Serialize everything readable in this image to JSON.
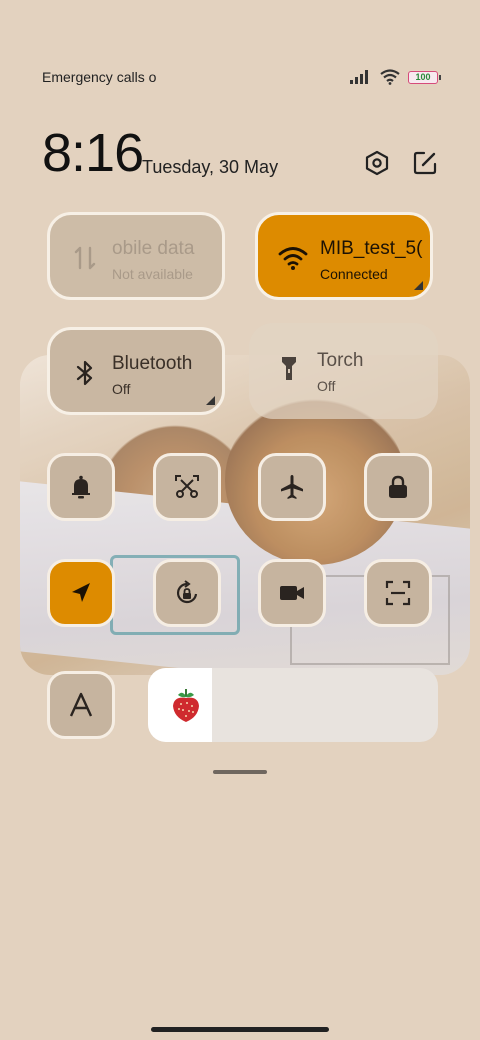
{
  "status_bar": {
    "carrier_text": "Emergency calls o",
    "battery_level": "100",
    "signal_icon": "signal-bars-icon",
    "wifi_icon": "wifi-icon"
  },
  "header": {
    "time": "8:16",
    "date": "Tuesday, 30 May",
    "settings_icon": "settings-hexagon-icon",
    "edit_icon": "edit-icon"
  },
  "tiles": {
    "mobile_data": {
      "title": "obile data",
      "subtitle": "Not available",
      "icon": "mobile-data-arrows-icon",
      "state": "unavailable"
    },
    "wifi": {
      "title": "MIB_test_5(",
      "subtitle": "Connected",
      "icon": "wifi-icon",
      "state": "on",
      "color": "#dd8b00"
    },
    "bluetooth": {
      "title": "Bluetooth",
      "subtitle": "Off",
      "icon": "bluetooth-icon",
      "state": "off"
    },
    "torch": {
      "title": "Torch",
      "subtitle": "Off",
      "icon": "torch-icon",
      "state": "off"
    }
  },
  "toggles": [
    {
      "name": "silent",
      "icon": "bell-icon",
      "state": "off"
    },
    {
      "name": "screenshot",
      "icon": "scissors-screenshot-icon",
      "state": "off"
    },
    {
      "name": "airplane-mode",
      "icon": "airplane-icon",
      "state": "off"
    },
    {
      "name": "lock-screen",
      "icon": "lock-icon",
      "state": "off"
    },
    {
      "name": "location",
      "icon": "location-arrow-icon",
      "state": "on"
    },
    {
      "name": "rotation-lock",
      "icon": "rotation-lock-icon",
      "state": "off"
    },
    {
      "name": "screen-recorder",
      "icon": "video-camera-icon",
      "state": "off"
    },
    {
      "name": "scanner",
      "icon": "scan-frame-icon",
      "state": "off"
    },
    {
      "name": "font-size",
      "icon": "font-a-icon",
      "state": "off"
    }
  ],
  "brightness": {
    "icon": "strawberry-icon",
    "level": 0.22
  },
  "colors": {
    "accent": "#dd8b00",
    "background": "#e3d2bf",
    "tile": "#c6b49f"
  }
}
